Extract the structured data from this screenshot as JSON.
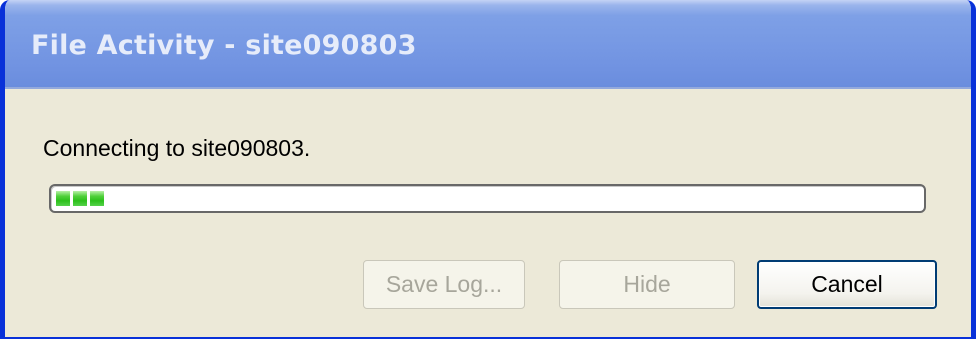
{
  "window": {
    "title": "File Activity - site090803"
  },
  "status": {
    "message": "Connecting to site090803."
  },
  "progress": {
    "filled_blocks": 3,
    "fill_color": "#2cc01b"
  },
  "buttons": {
    "save_log": {
      "label": "Save Log...",
      "enabled": false
    },
    "hide": {
      "label": "Hide",
      "enabled": false
    },
    "cancel": {
      "label": "Cancel",
      "enabled": true
    }
  },
  "colors": {
    "title_bar": "#7799e4",
    "frame": "#0831d9",
    "client_background": "#ece9d8",
    "disabled_text": "#a7a69b"
  }
}
